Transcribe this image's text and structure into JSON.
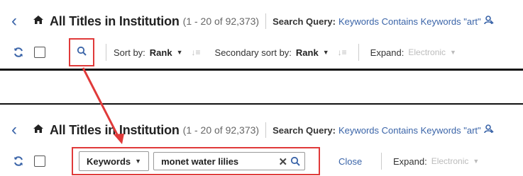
{
  "colors": {
    "accent": "#3a64a8",
    "highlight": "#e03a3a",
    "muted": "#bbbbbb"
  },
  "header": {
    "back_icon": "chevron-left-icon",
    "home_icon": "home-icon",
    "title": "All Titles in Institution",
    "count": "(1 - 20 of 92,373)",
    "search_query_label": "Search Query:",
    "search_query_value": "Keywords Contains Keywords \"art\"",
    "search_query_value_short": "Keywords Contains Keywords \"art\""
  },
  "toolbar": {
    "sort_by_label": "Sort by:",
    "sort_by_value": "Rank",
    "secondary_sort_label": "Secondary sort by:",
    "secondary_sort_value": "Rank",
    "expand_label": "Expand:",
    "expand_value": "Electronic"
  },
  "search_bar": {
    "field_select": "Keywords",
    "input_value": "monet water lilies",
    "close_label": "Close"
  }
}
